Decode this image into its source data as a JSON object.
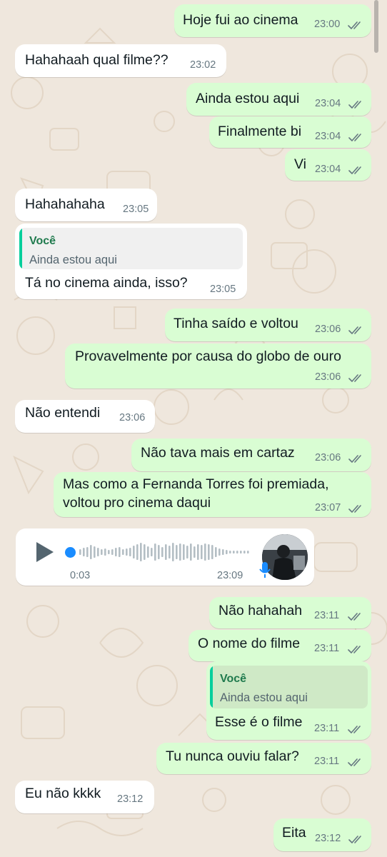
{
  "colors": {
    "outgoing_bubble": "#d9fdd3",
    "incoming_bubble": "#ffffff",
    "chat_background": "#efe7dd",
    "read_ticks": "#667781",
    "quote_author": "#1f7a4d",
    "audio_progress": "#1a8cff"
  },
  "messages": [
    {
      "direction": "out",
      "text": "Hoje fui ao cinema",
      "time": "23:00",
      "status": "read"
    },
    {
      "direction": "in",
      "text": "Hahahaah qual filme??",
      "time": "23:02"
    },
    {
      "direction": "out",
      "text": "Ainda estou aqui",
      "time": "23:04",
      "status": "read"
    },
    {
      "direction": "out",
      "text": "Finalmente bi",
      "time": "23:04",
      "status": "read"
    },
    {
      "direction": "out",
      "text": "Vi",
      "time": "23:04",
      "status": "read"
    },
    {
      "direction": "in",
      "text": "Hahahahaha",
      "time": "23:05"
    },
    {
      "direction": "in",
      "quote_author": "Você",
      "quote_text": "Ainda estou aqui",
      "text": "Tá no cinema ainda, isso?",
      "time": "23:05"
    },
    {
      "direction": "out",
      "text": "Tinha saído e voltou",
      "time": "23:06",
      "status": "read"
    },
    {
      "direction": "out",
      "text": "Provavelmente por causa do globo de ouro",
      "time": "23:06",
      "status": "read"
    },
    {
      "direction": "in",
      "text": "Não entendi",
      "time": "23:06"
    },
    {
      "direction": "out",
      "text": "Não tava mais em cartaz",
      "time": "23:06",
      "status": "read"
    },
    {
      "direction": "out",
      "line1": "Mas como a Fernanda Torres foi premiada,",
      "line2": "voltou pro cinema daqui",
      "time": "23:07",
      "status": "read"
    },
    {
      "direction": "in",
      "type": "voice",
      "duration": "0:03",
      "time": "23:09",
      "icon": "play-icon",
      "mic_icon": "mic-icon",
      "progress": 0
    },
    {
      "direction": "out",
      "text": "Não hahahah",
      "time": "23:11",
      "status": "read"
    },
    {
      "direction": "out",
      "text": "O nome do filme",
      "time": "23:11",
      "status": "read"
    },
    {
      "direction": "out",
      "quote_author": "Você",
      "quote_text": "Ainda estou aqui",
      "text": "Esse é o filme",
      "time": "23:11",
      "status": "read"
    },
    {
      "direction": "out",
      "text": "Tu nunca ouviu falar?",
      "time": "23:11",
      "status": "read"
    },
    {
      "direction": "in",
      "text": "Eu não kkkk",
      "time": "23:12"
    },
    {
      "direction": "out",
      "text": "Eita",
      "time": "23:12",
      "status": "read"
    }
  ]
}
